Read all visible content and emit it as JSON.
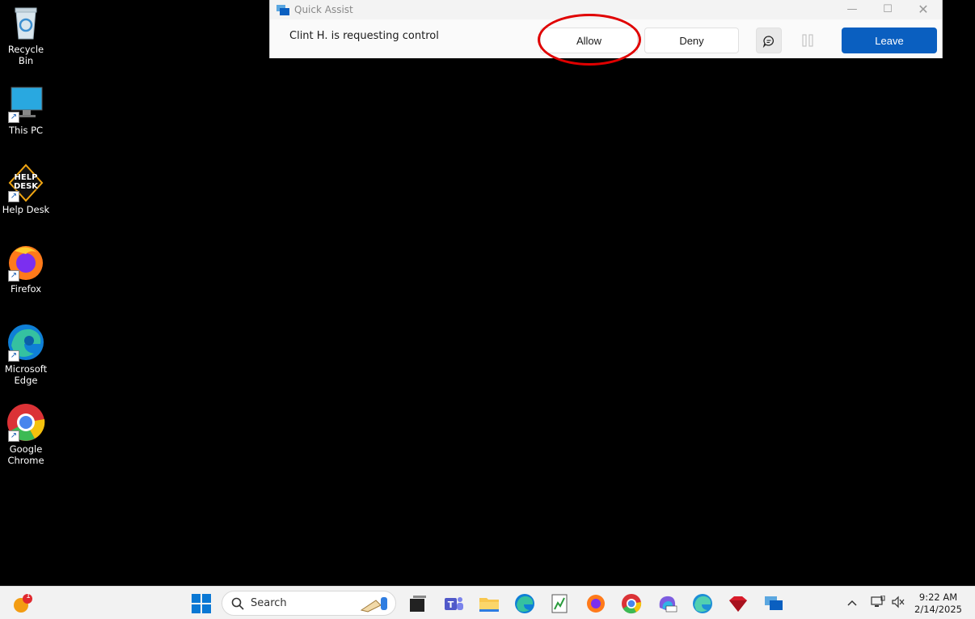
{
  "desktop": {
    "icons": [
      {
        "label": "Recycle Bin",
        "icon": "recycle-bin-icon"
      },
      {
        "label": "This PC",
        "icon": "monitor-icon"
      },
      {
        "label": "Help Desk",
        "icon": "help-desk-icon"
      },
      {
        "label": "Firefox",
        "icon": "firefox-icon"
      },
      {
        "label": "Microsoft Edge",
        "icon": "edge-icon"
      },
      {
        "label": "Google Chrome",
        "icon": "chrome-icon"
      }
    ]
  },
  "quick_assist": {
    "title": "Quick Assist",
    "message": "Clint H. is requesting control",
    "allow_label": "Allow",
    "deny_label": "Deny",
    "leave_label": "Leave",
    "accent": "#0a5fc0"
  },
  "taskbar": {
    "search_label": "Search",
    "notification_count": "1",
    "time": "9:22 AM",
    "date": "2/14/2025"
  }
}
